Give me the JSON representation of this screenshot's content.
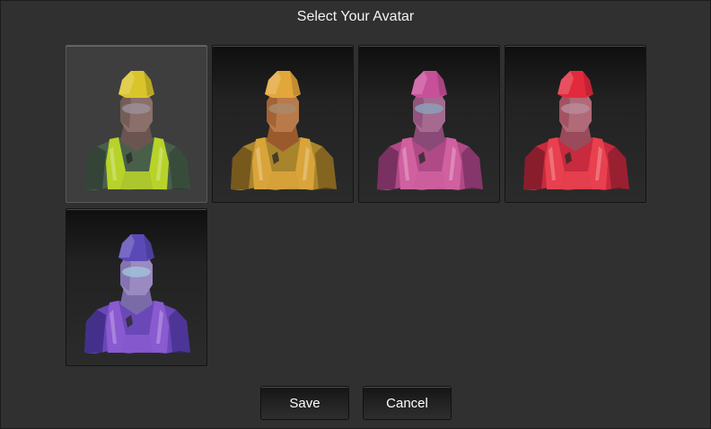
{
  "dialog": {
    "title": "Select Your Avatar"
  },
  "avatars": [
    {
      "icon": "avatar-green-figure",
      "selected": true,
      "helmet": "#d9c52a",
      "skin": "#6a5550",
      "face": "#8a6f6a",
      "visor": "#9a8f98",
      "body": "#48604a",
      "vest": "#b7d32a",
      "shade": "#2f3f33"
    },
    {
      "icon": "avatar-orange-figure",
      "selected": false,
      "helmet": "#e2a63a",
      "skin": "#9a5a2c",
      "face": "#b87a4a",
      "visor": "#a88a6a",
      "body": "#a8852c",
      "vest": "#d9a43a",
      "shade": "#6a4e1a"
    },
    {
      "icon": "avatar-pink-figure",
      "selected": false,
      "helmet": "#c8509a",
      "skin": "#8a4a78",
      "face": "#a56a90",
      "visor": "#8aa0b8",
      "body": "#b04a86",
      "vest": "#d060a0",
      "shade": "#6a2a58"
    },
    {
      "icon": "avatar-red-figure",
      "selected": false,
      "helmet": "#e22a3c",
      "skin": "#9a4a5a",
      "face": "#b06a78",
      "visor": "#b88a98",
      "body": "#c82a3e",
      "vest": "#e8404e",
      "shade": "#7a1a28"
    },
    {
      "icon": "avatar-purple-figure",
      "selected": false,
      "helmet": "#5a4ab8",
      "skin": "#7a6aa8",
      "face": "#9a8ac0",
      "visor": "#a0c0d8",
      "body": "#6a48b8",
      "vest": "#8a5ad0",
      "shade": "#3a2a80"
    }
  ],
  "actions": {
    "save_label": "Save",
    "cancel_label": "Cancel"
  }
}
